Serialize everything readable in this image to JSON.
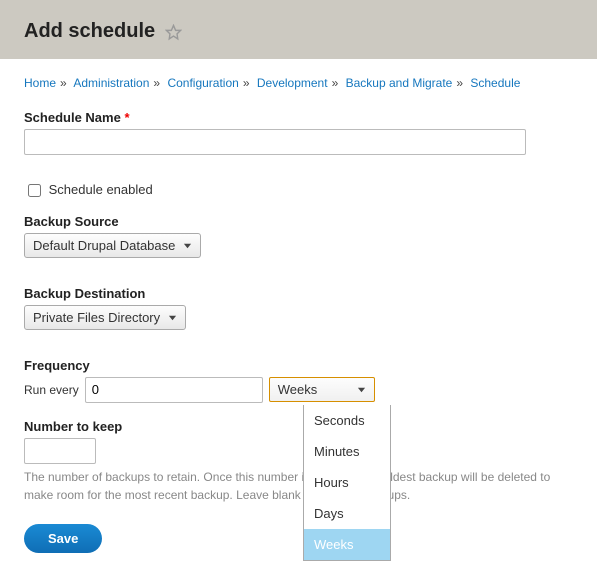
{
  "header": {
    "title": "Add schedule"
  },
  "breadcrumb": [
    {
      "label": "Home"
    },
    {
      "label": "Administration"
    },
    {
      "label": "Configuration"
    },
    {
      "label": "Development"
    },
    {
      "label": "Backup and Migrate"
    },
    {
      "label": "Schedule"
    }
  ],
  "form": {
    "schedule_name": {
      "label": "Schedule Name",
      "value": ""
    },
    "enabled": {
      "label": "Schedule enabled",
      "checked": false
    },
    "backup_source": {
      "label": "Backup Source",
      "selected": "Default Drupal Database"
    },
    "backup_destination": {
      "label": "Backup Destination",
      "selected": "Private Files Directory"
    },
    "frequency": {
      "label": "Frequency",
      "run_every_label": "Run every",
      "value": "0",
      "unit_selected": "Weeks",
      "unit_options": [
        "Seconds",
        "Minutes",
        "Hours",
        "Days",
        "Weeks"
      ]
    },
    "number_to_keep": {
      "label": "Number to keep",
      "value": "",
      "help": "The number of backups to retain. Once this number is reached, the oldest backup will be deleted to make room for the most recent backup. Leave blank to keep all backups."
    },
    "save_label": "Save"
  }
}
